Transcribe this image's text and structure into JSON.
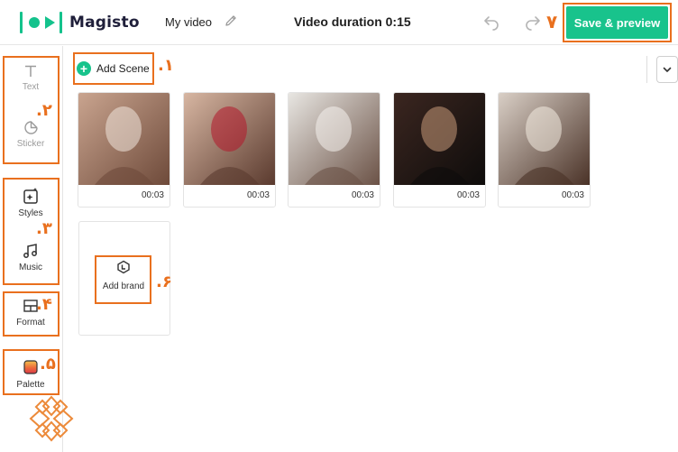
{
  "header": {
    "logo_text": "Magisto",
    "project_title": "My video",
    "duration_text": "Video duration 0:15",
    "save_label": "Save & preview",
    "brand_color": "#18c38c"
  },
  "annotations": {
    "add_scene": ".۱",
    "text_sticker": ".۲",
    "styles_music": ".۳",
    "format": ".۴",
    "palette": ".۵",
    "add_brand": ".۶",
    "save": "۷",
    "highlight_color": "#e9701e"
  },
  "sidebar": {
    "items": [
      {
        "label": "Text",
        "icon": "text-icon",
        "disabled": true
      },
      {
        "label": "Sticker",
        "icon": "sticker-icon",
        "disabled": true
      },
      {
        "label": "Styles",
        "icon": "styles-icon",
        "disabled": false
      },
      {
        "label": "Music",
        "icon": "music-icon",
        "disabled": false
      },
      {
        "label": "Format",
        "icon": "format-icon",
        "disabled": false
      },
      {
        "label": "Palette",
        "icon": "palette-icon",
        "disabled": false
      }
    ]
  },
  "main": {
    "add_scene_label": "Add Scene",
    "add_scene_icon": "plus-circle-icon",
    "collapse_icon": "chevron-down-icon",
    "scenes": [
      {
        "duration": "00:03",
        "palette": [
          "#c9a48f",
          "#6e4a3a",
          "#f0e6dc"
        ]
      },
      {
        "duration": "00:03",
        "palette": [
          "#d7b6a2",
          "#5a3a2e",
          "#b3162a"
        ]
      },
      {
        "duration": "00:03",
        "palette": [
          "#e8e6e2",
          "#6b5246",
          "#f5f3ef"
        ]
      },
      {
        "duration": "00:03",
        "palette": [
          "#3b2620",
          "#0e0c0b",
          "#c99a7a"
        ]
      },
      {
        "duration": "00:03",
        "palette": [
          "#d9cfc6",
          "#4a3227",
          "#f4ece2"
        ]
      }
    ],
    "add_brand_label": "Add brand",
    "add_brand_icon": "brand-logo-icon"
  }
}
